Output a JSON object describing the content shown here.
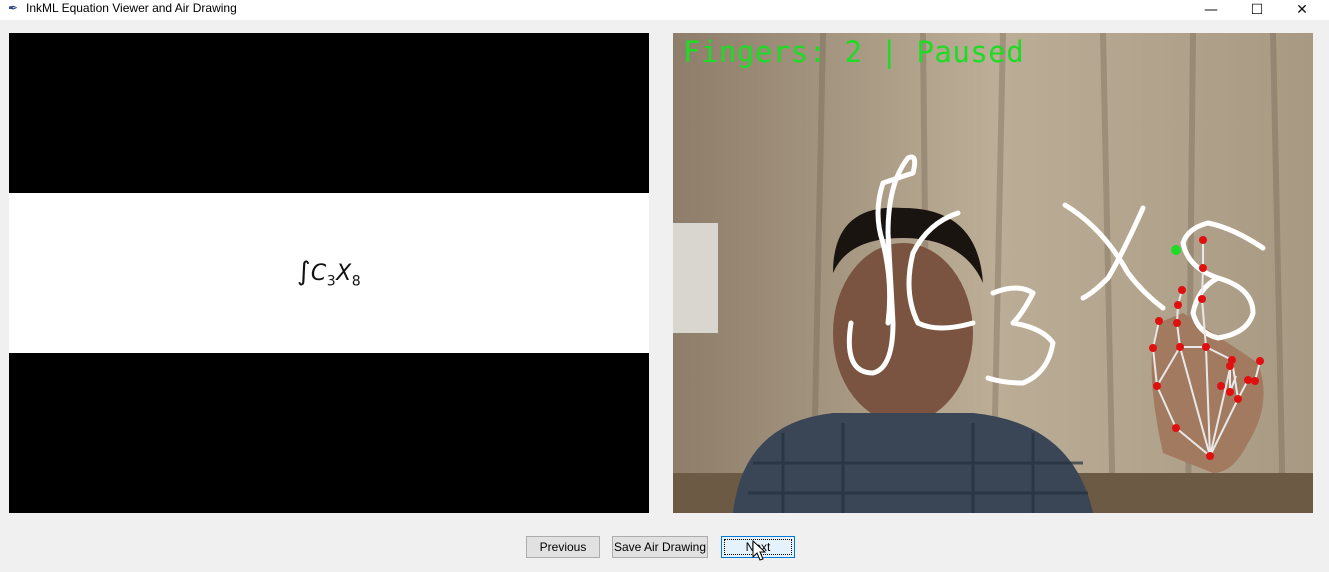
{
  "window": {
    "title": "InkML Equation Viewer and Air Drawing",
    "icon": "feather-icon",
    "controls": {
      "minimize": "—",
      "maximize": "☐",
      "close": "✕"
    }
  },
  "equation_panel": {
    "integral": "∫",
    "term1": "C",
    "sub1": "3",
    "term2": "X",
    "sub2": "8"
  },
  "camera_panel": {
    "status": "Fingers: 2 | Paused",
    "status_color": "#1cdc23",
    "drawn_strokes": "∫C3X8",
    "landmark_color": "#e01010"
  },
  "buttons": {
    "previous": "Previous",
    "save": "Save Air Drawing",
    "next": "Next"
  }
}
